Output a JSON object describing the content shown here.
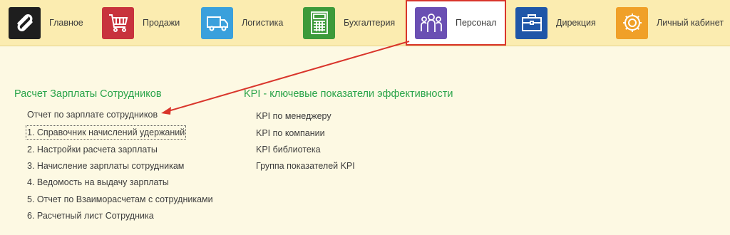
{
  "sections": [
    {
      "label": "Главное",
      "icon": "logo-icon",
      "color": "#1e1e1e"
    },
    {
      "label": "Продажи",
      "icon": "shopping-cart-icon",
      "color": "#c8333d"
    },
    {
      "label": "Логистика",
      "icon": "truck-icon",
      "color": "#3aa0dc"
    },
    {
      "label": "Бухгалтерия",
      "icon": "calculator-icon",
      "color": "#3d9a3a"
    },
    {
      "label": "Персонал",
      "icon": "people-icon",
      "color": "#6a4fb3"
    },
    {
      "label": "Дирекция",
      "icon": "briefcase-icon",
      "color": "#1f56a8"
    },
    {
      "label": "Личный кабинет",
      "icon": "gear-icon",
      "color": "#f0a028"
    }
  ],
  "active_section": "Персонал",
  "accent_green": "#2aa44a",
  "highlight_red": "#d9352b",
  "salary_group": {
    "title": "Расчет Зарплаты Сотрудников",
    "items": [
      "Отчет по зарплате сотрудников",
      "1. Справочник начислений удержаний",
      "2. Настройки расчета зарплаты",
      "3. Начисление зарплаты сотрудникам",
      "4. Ведомость на выдачу зарплаты",
      "5. Отчет по Взаиморасчетам с сотрудниками",
      "6. Расчетный лист Сотрудника"
    ]
  },
  "kpi_group": {
    "title": "KPI - ключевые показатели эффективности",
    "items": [
      "KPI по менеджеру",
      "KPI по компании",
      "KPI библиотека",
      "Группа показателей KPI"
    ]
  }
}
